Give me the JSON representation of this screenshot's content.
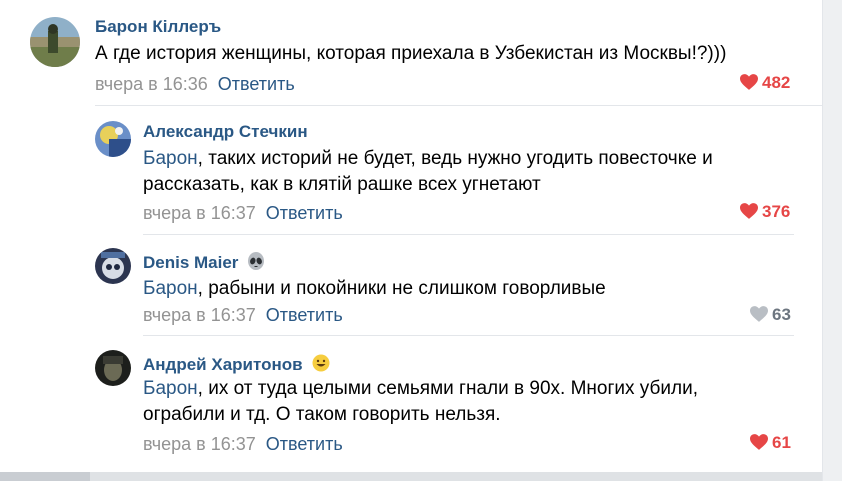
{
  "comments": [
    {
      "author": "Барон Кiллеръ",
      "mention": "",
      "text": "А где история женщины, которая приехала в Узбекистан из Москвы!?)))",
      "line2": "",
      "time": "вчера в 16:36",
      "reply_label": "Ответить",
      "likes": "482",
      "liked": true
    },
    {
      "author": "Александр Стечкин",
      "mention": "Барон",
      "text": ", таких историй не будет, ведь нужно угодить повесточке и",
      "line2": "рассказать, как в клятій рашке всех угнетают",
      "time": "вчера в 16:37",
      "reply_label": "Ответить",
      "likes": "376",
      "liked": true
    },
    {
      "author": "Denis Maier",
      "mention": "Барон",
      "text": ", рабыни и покойники не слишком говорливые",
      "line2": "",
      "time": "вчера в 16:37",
      "reply_label": "Ответить",
      "likes": "63",
      "liked": false
    },
    {
      "author": "Андрей Харитонов",
      "mention": "Барон",
      "text": ", их от туда целыми семьями гнали в 90х. Многих убили,",
      "line2": "ограбили и тд. О таком говорить нельзя.",
      "time": "вчера в 16:37",
      "reply_label": "Ответить",
      "likes": "61",
      "liked": true
    }
  ],
  "colors": {
    "link": "#2a5885",
    "meta": "#939393",
    "like_active": "#e64646",
    "like_inactive": "#a0a4aa"
  },
  "icons": {
    "author_badge_2": "alien-face-emoji",
    "author_badge_3": "grinning-face-emoji",
    "like": "heart-icon"
  }
}
